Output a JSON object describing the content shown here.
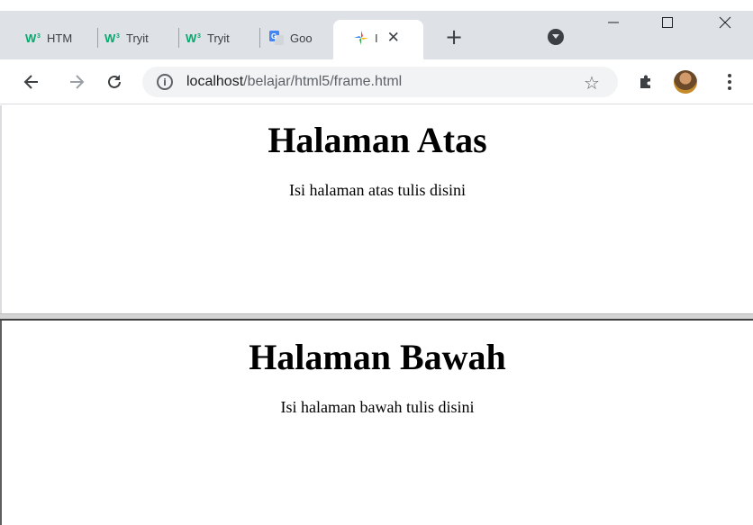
{
  "browser": {
    "tabs": [
      {
        "label": "HTM",
        "favicon": "w3schools-icon"
      },
      {
        "label": "Tryit",
        "favicon": "w3schools-icon"
      },
      {
        "label": "Tryit",
        "favicon": "w3schools-icon"
      },
      {
        "label": "Goo",
        "favicon": "google-translate-icon"
      },
      {
        "label": "I",
        "favicon": "pinwheel-icon",
        "active": true
      }
    ],
    "address_bar": {
      "host": "localhost",
      "path": "/belajar/html5/frame.html"
    },
    "colors": {
      "tabstrip": "#dee1e6",
      "w3_green": "#04aa6d",
      "google_blue": "#4285f4"
    }
  },
  "frames": {
    "top": {
      "heading": "Halaman Atas",
      "text": "Isi halaman atas tulis disini"
    },
    "bottom": {
      "heading": "Halaman Bawah",
      "text": "Isi halaman bawah tulis disini"
    }
  }
}
